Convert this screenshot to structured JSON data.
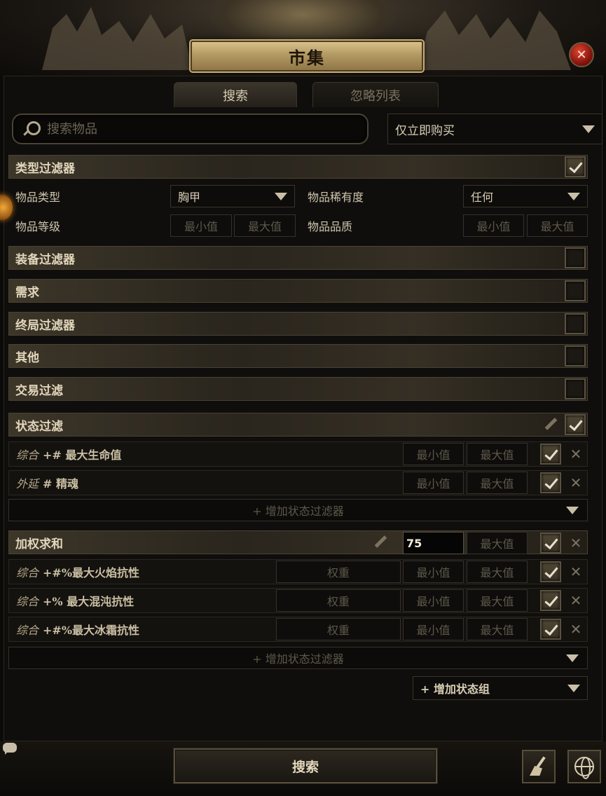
{
  "window": {
    "title": "市集",
    "close_label": "✕"
  },
  "tabs": [
    {
      "label": "搜索",
      "active": true
    },
    {
      "label": "忽略列表",
      "active": false
    }
  ],
  "search": {
    "placeholder": "搜索物品",
    "value": "",
    "buy_mode": "仅立即购买"
  },
  "type_filters": {
    "label": "类型过滤器",
    "checked": true,
    "item_type_label": "物品类型",
    "item_type_value": "胸甲",
    "rarity_label": "物品稀有度",
    "rarity_value": "任何",
    "level_label": "物品等级",
    "quality_label": "物品品质",
    "min_placeholder": "最小值",
    "max_placeholder": "最大值"
  },
  "collapsed_filters": [
    {
      "label": "装备过滤器",
      "checked": false
    },
    {
      "label": "需求",
      "checked": false
    },
    {
      "label": "终局过滤器",
      "checked": false
    },
    {
      "label": "其他",
      "checked": false
    },
    {
      "label": "交易过滤",
      "checked": false
    }
  ],
  "stat_filters": {
    "label": "状态过滤",
    "checked": true,
    "rows": [
      {
        "prefix": "综合",
        "stat": "+# 最大生命值",
        "min": "最小值",
        "max": "最大值",
        "checked": true
      },
      {
        "prefix": "外延",
        "stat": "# 精魂",
        "min": "最小值",
        "max": "最大值",
        "checked": true
      }
    ],
    "add_label": "+ 增加状态过滤器"
  },
  "weighted_sum": {
    "label": "加权求和",
    "min_value": "75",
    "max_placeholder": "最大值",
    "checked": true,
    "weight_placeholder": "权重",
    "rows": [
      {
        "prefix": "综合",
        "stat": "+#%最大火焰抗性",
        "weight": "权重",
        "min": "最小值",
        "max": "最大值",
        "checked": true
      },
      {
        "prefix": "综合",
        "stat": "+% 最大混沌抗性",
        "weight": "权重",
        "min": "最小值",
        "max": "最大值",
        "checked": true
      },
      {
        "prefix": "综合",
        "stat": "+#%最大冰霜抗性",
        "weight": "权重",
        "min": "最小值",
        "max": "最大值",
        "checked": true
      }
    ],
    "add_label": "+ 增加状态过滤器"
  },
  "add_group_label": "+ 增加状态组",
  "footer": {
    "search_button": "搜索"
  },
  "icons": [
    "search-icon",
    "close-icon",
    "pencil-icon",
    "broom-icon",
    "globe-icon",
    "chat-icon",
    "dropdown-caret-icon"
  ],
  "colors": {
    "title_plate": "#c7ad72",
    "close_button": "#b0261a",
    "text": "#c9bfa8"
  }
}
